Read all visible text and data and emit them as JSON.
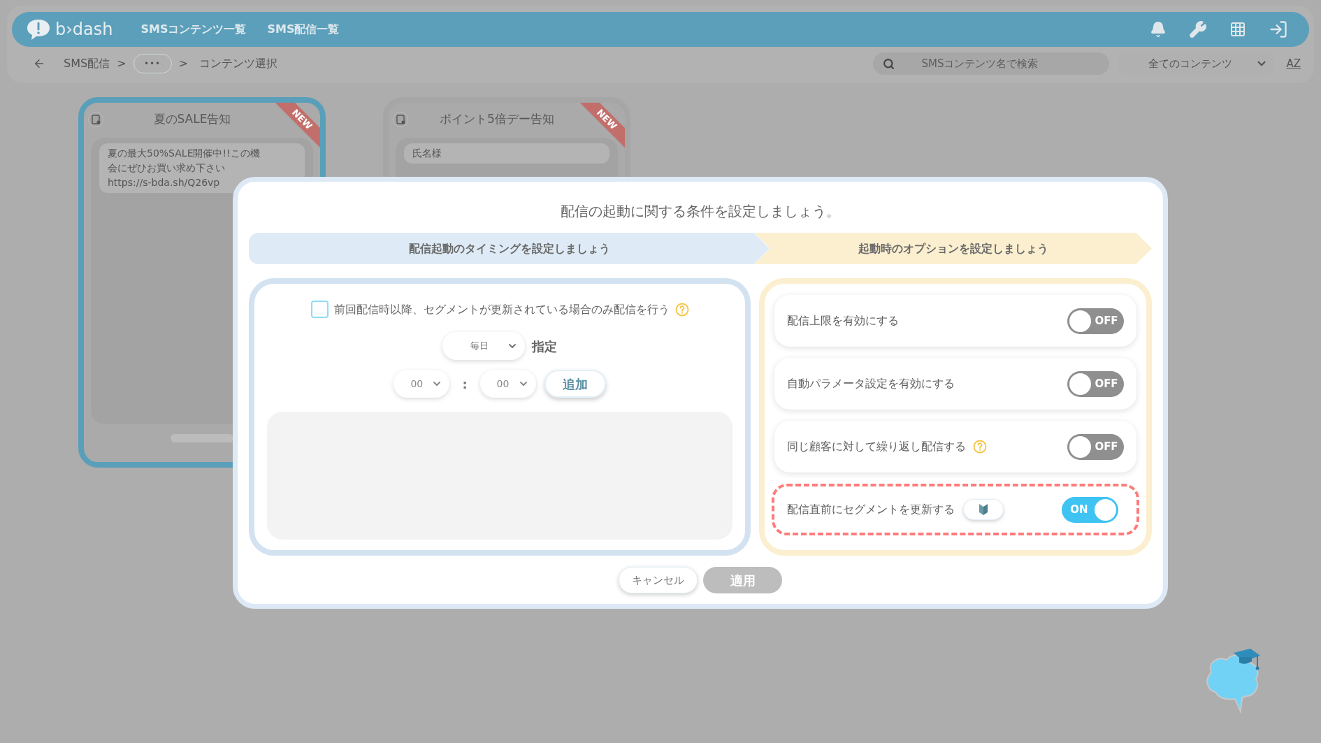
{
  "header": {
    "logo": "b›dash",
    "nav": [
      {
        "label": "SMSコンテンツ一覧"
      },
      {
        "label": "SMS配信一覧"
      }
    ]
  },
  "breadcrumb": {
    "items": [
      {
        "kind": "link",
        "label": "SMS配信"
      },
      {
        "kind": "sep",
        "label": ">"
      },
      {
        "kind": "more",
        "label": "•••"
      },
      {
        "kind": "sep",
        "label": ">"
      },
      {
        "kind": "current",
        "label": "コンテンツ選択"
      }
    ],
    "search": {
      "placeholder": "SMSコンテンツ名で検索"
    },
    "filter": "全てのコンテンツ",
    "sort": "AZ"
  },
  "cards": [
    {
      "title": "夏のSALE告知",
      "selected": true,
      "ribbon": "NEW",
      "lines": [
        "夏の最大50%SALE開催中!!この機",
        "会にぜひお買い求め下さい",
        "https://s-bda.sh/Q26vp"
      ]
    },
    {
      "title": "ポイント5倍デー告知",
      "selected": false,
      "ribbon": "NEW",
      "lines": [
        "氏名様"
      ]
    }
  ],
  "modal": {
    "title": "配信の起動に関する条件を設定しましょう。",
    "steps": [
      {
        "label": "配信起動のタイミングを設定しましょう"
      },
      {
        "label": "起動時のオプションを設定しましょう"
      }
    ],
    "timing": {
      "checkbox": {
        "label": "前回配信時以降、セグメントが更新されている場合のみ配信を行う",
        "checked": false
      },
      "frequency": "毎日",
      "frequency_suffix": "指定",
      "hour": "00",
      "separator": ":",
      "minute": "00",
      "add_button": "追加"
    },
    "options": [
      {
        "label": "配信上限を有効にする",
        "on": false,
        "toggle_label": "OFF",
        "help": false,
        "beginner_badge": false,
        "highlighted": false
      },
      {
        "label": "自動パラメータ設定を有効にする",
        "on": false,
        "toggle_label": "OFF",
        "help": false,
        "beginner_badge": false,
        "highlighted": false
      },
      {
        "label": "同じ顧客に対して繰り返し配信する",
        "on": false,
        "toggle_label": "OFF",
        "help": true,
        "beginner_badge": false,
        "highlighted": false
      },
      {
        "label": "配信直前にセグメントを更新する",
        "on": true,
        "toggle_label": "ON",
        "help": false,
        "beginner_badge": true,
        "highlighted": true
      }
    ],
    "buttons": [
      {
        "label": "キャンセル",
        "disabled": false
      },
      {
        "label": "適用",
        "disabled": true
      }
    ]
  }
}
